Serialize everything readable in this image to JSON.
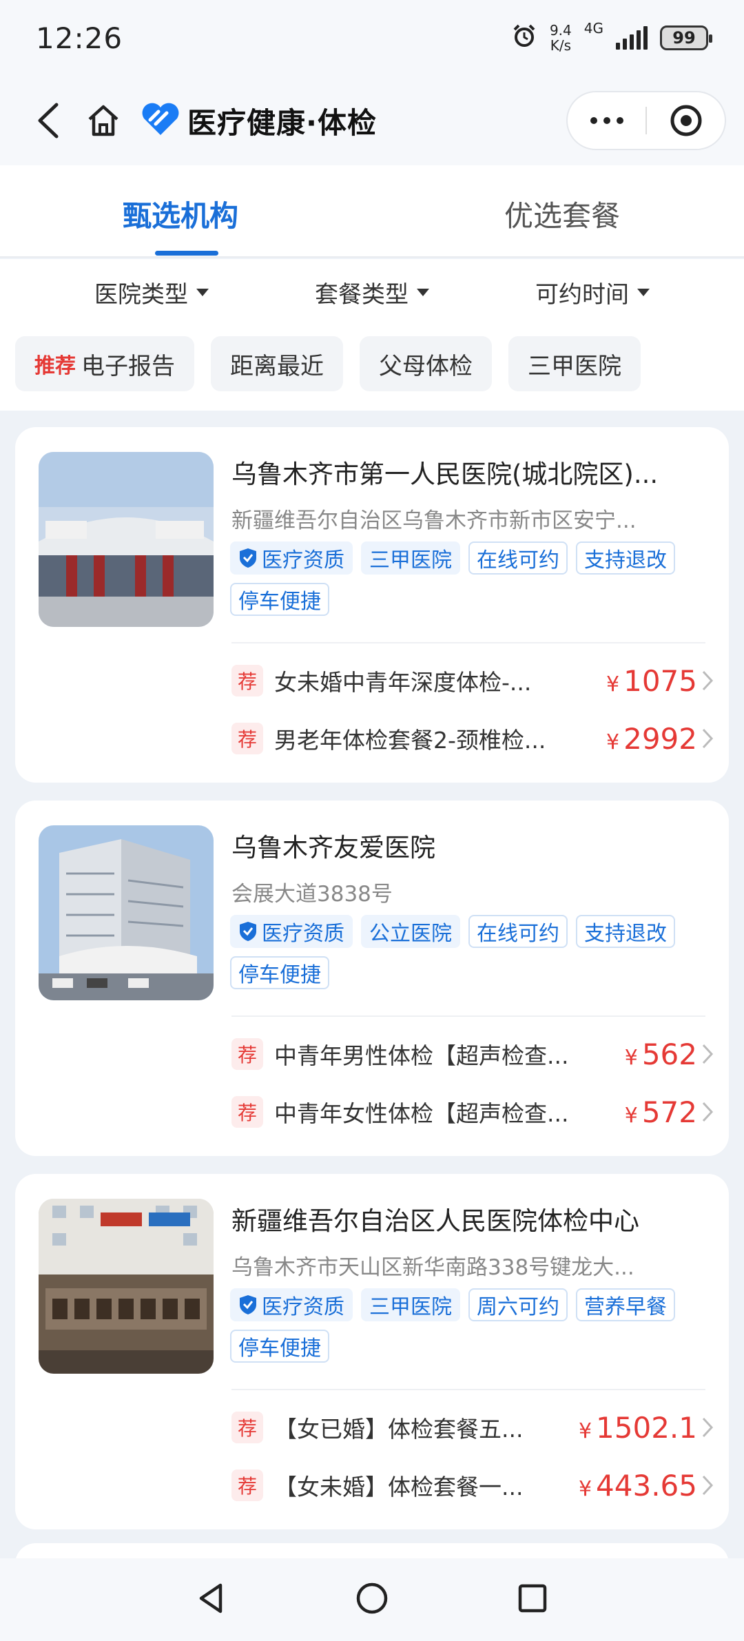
{
  "status_bar": {
    "time": "12:26",
    "net_speed_value": "9.4",
    "net_speed_unit": "K/s",
    "network": "4G",
    "battery": "99",
    "icons": [
      "alarm-icon",
      "signal-icon",
      "battery-icon"
    ]
  },
  "nav": {
    "brand_title": "医疗健康·体检",
    "icons": [
      "back-icon",
      "home-icon",
      "brand-logo",
      "more-icon",
      "close-mini-program-icon"
    ]
  },
  "tabs": [
    {
      "label": "甄选机构",
      "active": true
    },
    {
      "label": "优选套餐",
      "active": false
    }
  ],
  "filters": [
    {
      "label": "医院类型"
    },
    {
      "label": "套餐类型"
    },
    {
      "label": "可约时间"
    }
  ],
  "chips": {
    "rec_label": "推荐",
    "items": [
      "电子报告",
      "距离最近",
      "父母体检",
      "三甲医院"
    ]
  },
  "colors": {
    "accent": "#1a6fd8",
    "price": "#e53935",
    "background": "#eef2f7"
  },
  "hospitals": [
    {
      "name": "乌鲁木齐市第一人民医院(城北院区)...",
      "address": "新疆维吾尔自治区乌鲁木齐市新市区安宁...",
      "tags": [
        "医疗资质",
        "三甲医院",
        "在线可约",
        "支持退改",
        "停车便捷"
      ],
      "packages": [
        {
          "rec": "荐",
          "name": "女未婚中青年深度体检-...",
          "currency": "¥",
          "price": "1075"
        },
        {
          "rec": "荐",
          "name": "男老年体检套餐2-颈椎检...",
          "currency": "¥",
          "price": "2992"
        }
      ]
    },
    {
      "name": "乌鲁木齐友爱医院",
      "address": "会展大道3838号",
      "tags": [
        "医疗资质",
        "公立医院",
        "在线可约",
        "支持退改",
        "停车便捷"
      ],
      "packages": [
        {
          "rec": "荐",
          "name": "中青年男性体检【超声检查...",
          "currency": "¥",
          "price": "562"
        },
        {
          "rec": "荐",
          "name": "中青年女性体检【超声检查...",
          "currency": "¥",
          "price": "572"
        }
      ]
    },
    {
      "name": "新疆维吾尔自治区人民医院体检中心",
      "address": "乌鲁木齐市天山区新华南路338号键龙大...",
      "tags": [
        "医疗资质",
        "三甲医院",
        "周六可约",
        "营养早餐",
        "停车便捷"
      ],
      "packages": [
        {
          "rec": "荐",
          "name": "【女已婚】体检套餐五...",
          "currency": "¥",
          "price": "1502.1"
        },
        {
          "rec": "荐",
          "name": "【女未婚】体检套餐一...",
          "currency": "¥",
          "price": "443.65"
        }
      ]
    }
  ],
  "system_nav": [
    "back-triangle-icon",
    "home-circle-icon",
    "recents-square-icon"
  ]
}
